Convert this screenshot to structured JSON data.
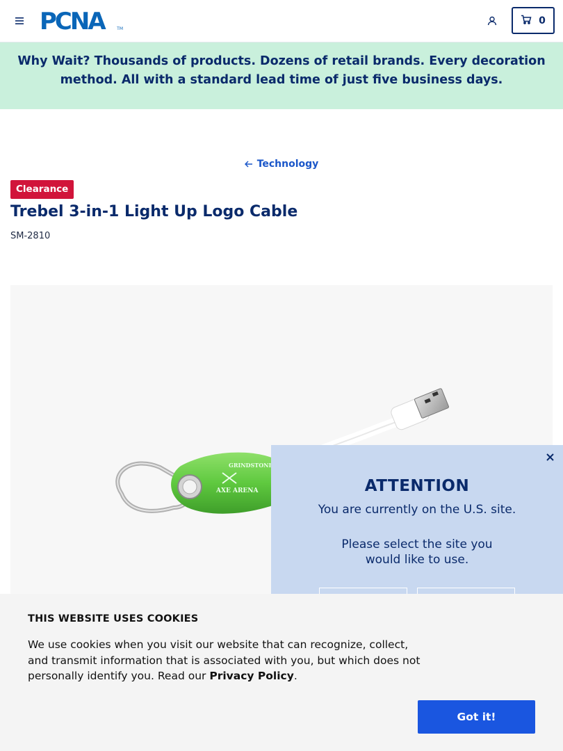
{
  "header": {
    "logo_text": "PCNA",
    "logo_tm": "TM",
    "cart_count": "0"
  },
  "promo": {
    "lead": "Why Wait?",
    "text": " Thousands of products. Dozens of retail brands. Every decoration method. All with a standard lead time of just five business days."
  },
  "breadcrumb": {
    "label": "Technology"
  },
  "product": {
    "badge": "Clearance",
    "title": "Trebel 3-in-1 Light Up Logo Cable",
    "sku": "SM-2810",
    "logo_line1": "GRINDSTONE",
    "logo_line2": "AXE ARENA",
    "accent_green": "#5fc93f"
  },
  "attention": {
    "title": "ATTENTION",
    "line1": "You are currently on the U.S. site.",
    "line2": "Please select the site you would like to use."
  },
  "cookie": {
    "heading": "THIS WEBSITE USES COOKIES",
    "message": "We use cookies when you visit our website that can recognize, collect, and transmit information that is associated with you, but which does not personally identify you. Read our ",
    "link": "Privacy Policy",
    "trailing": ".",
    "button": "Got it!"
  },
  "colors": {
    "navy": "#0a2a6b",
    "brand_blue": "#0a66b8",
    "promo_bg": "#c9f0dc",
    "badge_red": "#d1143a",
    "modal_bg": "#c8d8f0",
    "button_blue": "#1a56e0"
  }
}
